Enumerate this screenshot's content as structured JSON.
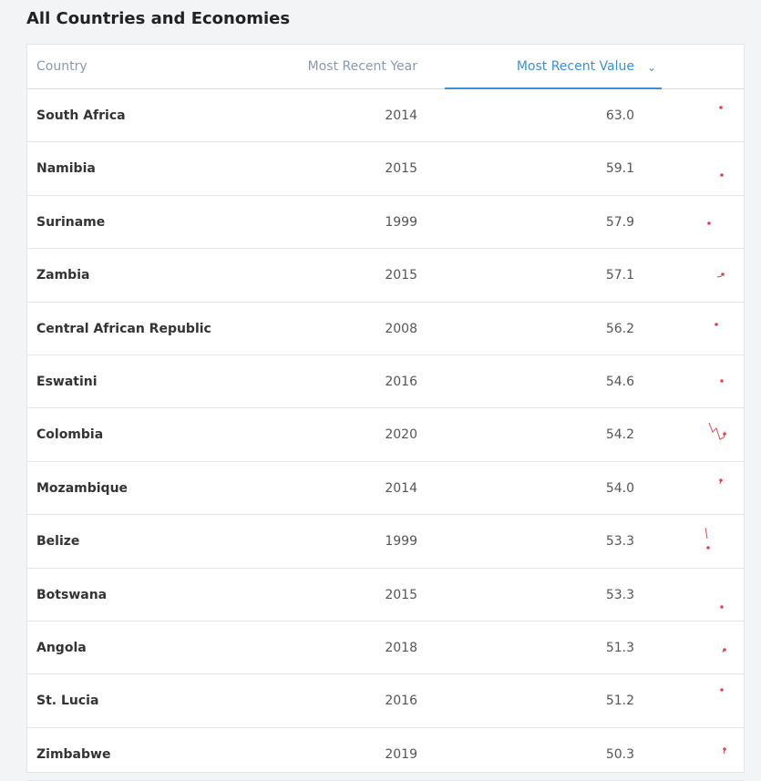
{
  "page": {
    "title": "All Countries and Economies"
  },
  "table": {
    "headers": {
      "country": "Country",
      "year": "Most Recent Year",
      "value": "Most Recent Value"
    },
    "sort_icon": "chevron-down-icon",
    "accent": "#3a8fd9",
    "spark_color": "#e0454f",
    "rows": [
      {
        "country": "South Africa",
        "year": "2014",
        "value": "63.0"
      },
      {
        "country": "Namibia",
        "year": "2015",
        "value": "59.1"
      },
      {
        "country": "Suriname",
        "year": "1999",
        "value": "57.9"
      },
      {
        "country": "Zambia",
        "year": "2015",
        "value": "57.1"
      },
      {
        "country": "Central African Republic",
        "year": "2008",
        "value": "56.2"
      },
      {
        "country": "Eswatini",
        "year": "2016",
        "value": "54.6"
      },
      {
        "country": "Colombia",
        "year": "2020",
        "value": "54.2"
      },
      {
        "country": "Mozambique",
        "year": "2014",
        "value": "54.0"
      },
      {
        "country": "Belize",
        "year": "1999",
        "value": "53.3"
      },
      {
        "country": "Botswana",
        "year": "2015",
        "value": "53.3"
      },
      {
        "country": "Angola",
        "year": "2018",
        "value": "51.3"
      },
      {
        "country": "St. Lucia",
        "year": "2016",
        "value": "51.2"
      },
      {
        "country": "Zimbabwe",
        "year": "2019",
        "value": "50.3"
      }
    ]
  }
}
